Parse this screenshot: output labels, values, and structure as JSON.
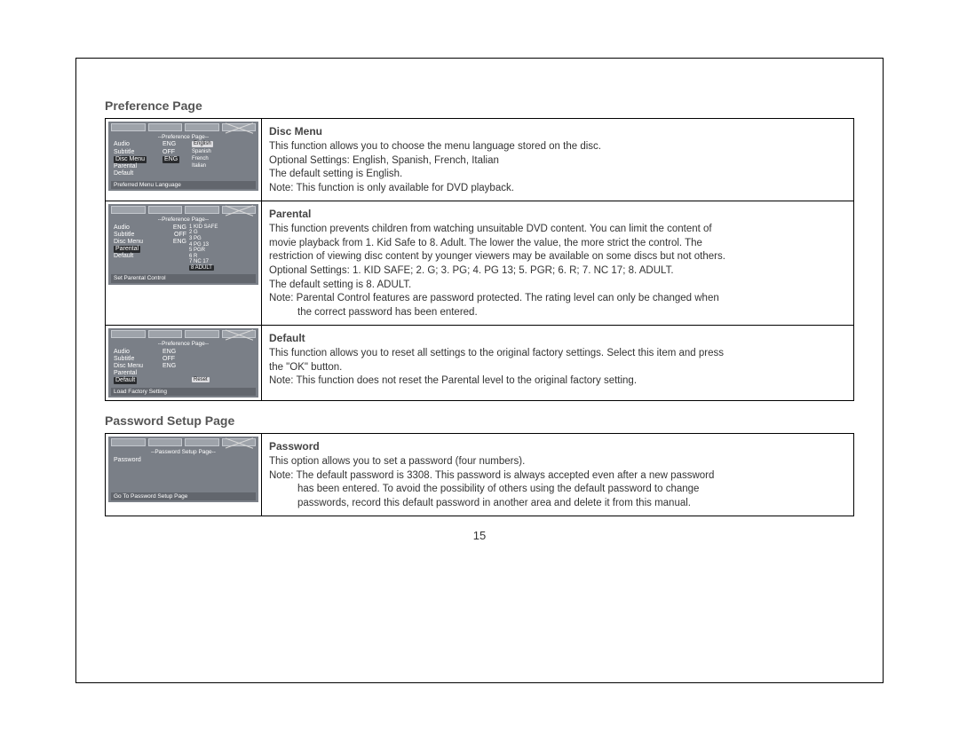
{
  "page_number": "15",
  "sections": {
    "preference": {
      "title": "Preference Page",
      "rows": {
        "disc_menu": {
          "heading": "Disc Menu",
          "l1": "This function allows you to choose the menu language stored on the disc.",
          "l2": "Optional Settings: English, Spanish, French, Italian",
          "l3": "The default setting is English.",
          "l4": "Note: This function is only available for DVD playback.",
          "osd": {
            "header": "--Preference Page--",
            "items": [
              {
                "label": "Audio",
                "val": "ENG",
                "opt": "English",
                "hl_opt": true
              },
              {
                "label": "Subtitle",
                "val": "OFF",
                "opt": "Spanish"
              },
              {
                "label": "Disc Menu",
                "val": "ENG",
                "opt": "French",
                "hl_row": true
              },
              {
                "label": "Parental",
                "val": "",
                "opt": "Italian"
              },
              {
                "label": "Default",
                "val": "",
                "opt": ""
              }
            ],
            "footer": "Preferred Menu Language"
          }
        },
        "parental": {
          "heading": "Parental",
          "l1": "This function prevents children from watching unsuitable DVD content. You can limit the content of",
          "l2": "movie playback from 1. Kid Safe to 8. Adult. The lower the value, the more strict the control. The",
          "l3": "restriction of viewing disc content by younger viewers may be available on some discs but not others.",
          "l4": "Optional Settings: 1.  KID SAFE;   2.  G;   3.  PG;   4.  PG 13;   5.  PGR;   6.  R;   7.  NC 17;   8.  ADULT.",
          "l5": "The default setting is 8.  ADULT.",
          "l6": "Note: Parental Control features are password protected. The rating level can only be changed when",
          "l7": "the correct password has been entered.",
          "osd": {
            "header": "--Preference Page--",
            "items": [
              {
                "label": "Audio",
                "val": "ENG"
              },
              {
                "label": "Subtitle",
                "val": "OFF"
              },
              {
                "label": "Disc Menu",
                "val": "ENG"
              },
              {
                "label": "Parental",
                "val": "",
                "hl_row": true
              },
              {
                "label": "Default",
                "val": ""
              }
            ],
            "ratings": [
              "1 KID SAFE",
              "2 G",
              "3 PG",
              "4 PG 13",
              "5 PGR",
              "6 R",
              "7 NC 17",
              "8 ADULT"
            ],
            "ratings_hl_index": 7,
            "footer": "Set Parental Control"
          }
        },
        "default": {
          "heading": "Default",
          "l1": "This function allows you to reset all settings to the original factory settings. Select this item and press",
          "l2": "the \"OK\" button.",
          "l3": "Note: This function does not reset the Parental level to the original factory setting.",
          "osd": {
            "header": "--Preference Page--",
            "items": [
              {
                "label": "Audio",
                "val": "ENG"
              },
              {
                "label": "Subtitle",
                "val": "OFF"
              },
              {
                "label": "Disc Menu",
                "val": "ENG"
              },
              {
                "label": "Parental",
                "val": ""
              },
              {
                "label": "Default",
                "val": "Reset",
                "hl_row": true,
                "hl_val": true
              }
            ],
            "footer": "Load Factory Setting"
          }
        }
      }
    },
    "password": {
      "title": "Password Setup Page",
      "rows": {
        "password": {
          "heading": "Password",
          "l1": "This option allows you to set a password (four numbers).",
          "l2": "Note: The default password is 3308. This password is always accepted even after a new password",
          "l3": "has been entered. To avoid the possibility of others using the default password to change",
          "l4": "passwords, record this default password in another area and delete it from this manual.",
          "osd": {
            "header": "--Password Setup Page--",
            "items": [
              {
                "label": "Password",
                "val": ""
              }
            ],
            "footer": "Go To Password Setup Page"
          }
        }
      }
    }
  }
}
